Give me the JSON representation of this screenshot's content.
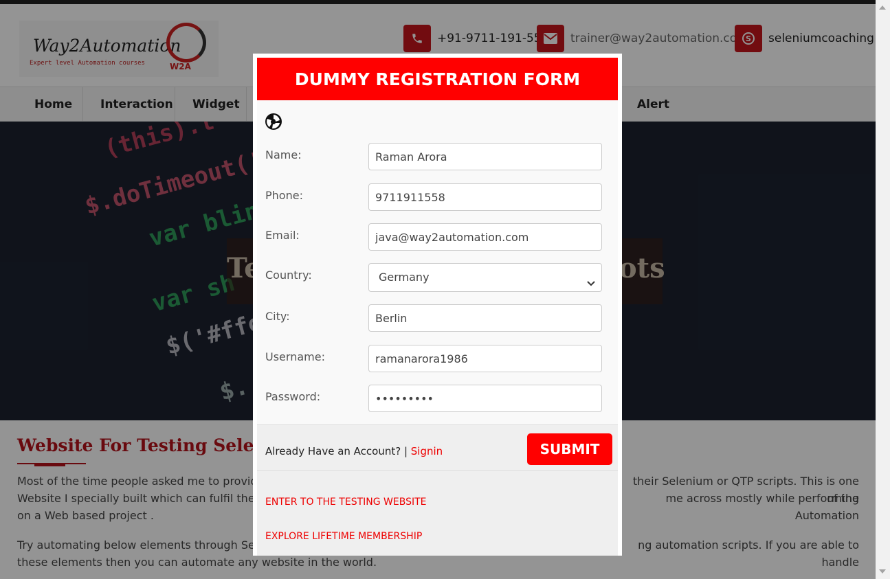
{
  "header": {
    "logo_title": "Way2Automation",
    "logo_tagline": "Expert level Automation courses",
    "logo_mark": "W2A",
    "phone": "+91-9711-191-558",
    "email": "trainer@way2automation.com",
    "skype": "seleniumcoaching",
    "icons": [
      "phone-icon",
      "envelope-icon",
      "skype-icon"
    ]
  },
  "nav": {
    "items": [
      "Home",
      "Interaction",
      "Widget",
      "Alert"
    ]
  },
  "hero": {
    "title_left": "Te",
    "title_right": "ots",
    "code_lines": [
      "(this).t",
      "$.doTimeout('",
      "var blin",
      "var sh",
      "$('#ffo",
      "$."
    ]
  },
  "content": {
    "title": "Website For Testing Seleniu",
    "para1_left": "Most of the time people asked me to provide a",
    "para1_left2": "Website I specially built which can fulfil the bas",
    "para1_left3": "on a Web based project .",
    "para1_right": "their Selenium or QTP scripts. This is one of the",
    "para1_right2": "me across mostly while performing Automation",
    "para2_left": "Try automating below elements through Seleni",
    "para2_left2": "these elements then you can automate any website in the world.",
    "para2_right": "ng automation scripts. If you are able to handle"
  },
  "modal": {
    "title": "DUMMY REGISTRATION FORM",
    "fields": {
      "name_label": "Name:",
      "name_value": "Raman Arora",
      "phone_label": "Phone:",
      "phone_value": "9711911558",
      "email_label": "Email:",
      "email_value": "java@way2automation.com",
      "country_label": "Country:",
      "country_value": "Germany",
      "city_label": "City:",
      "city_value": "Berlin",
      "username_label": "Username:",
      "username_value": "ramanarora1986",
      "password_label": "Password:",
      "password_value": "•••••••••"
    },
    "already_text": "Already Have an Account? | ",
    "signin_label": "Signin",
    "submit_label": "SUBMIT",
    "link_enter": "ENTER TO THE TESTING WEBSITE",
    "link_membership": "EXPLORE LIFETIME MEMBERSHIP"
  },
  "colors": {
    "accent": "#ff0000",
    "brand_dark_red": "#c4161c"
  }
}
